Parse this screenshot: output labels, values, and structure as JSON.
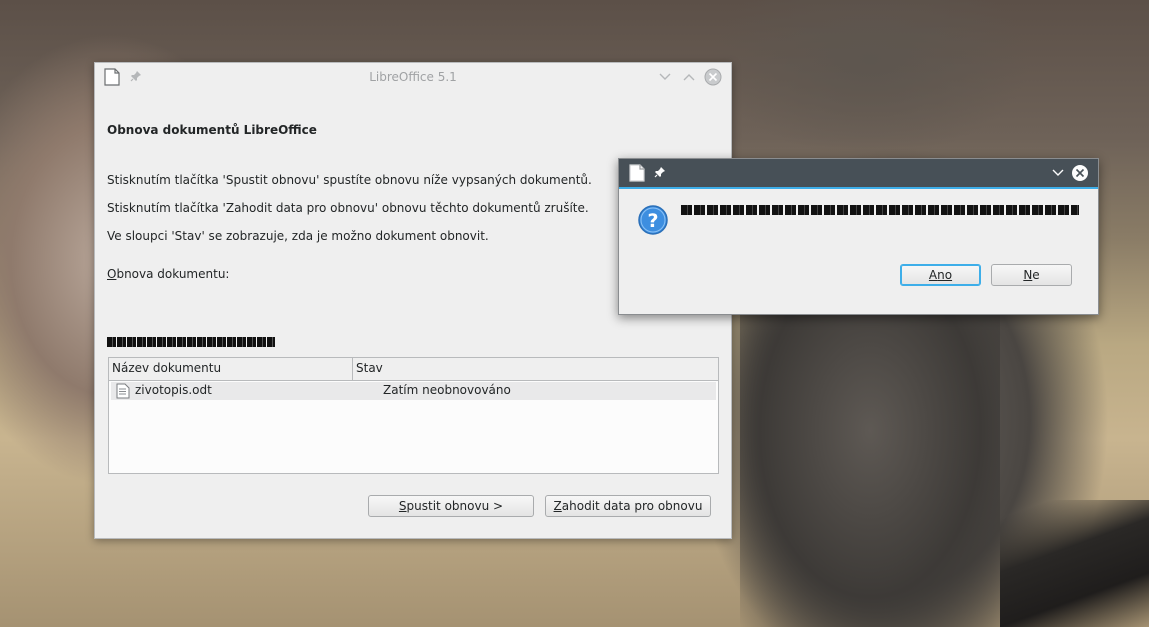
{
  "main_window": {
    "title": "LibreOffice 5.1",
    "heading": "Obnova dokumentů LibreOffice",
    "line1": "Stisknutím tlačítka 'Spustit obnovu' spustíte obnovu níže vypsaných dokumentů.",
    "line2": "Stisknutím tlačítka 'Zahodit data pro obnovu' obnovu těchto dokumentů zrušíte.",
    "line3": "Ve sloupci 'Stav' se zobrazuje, zda je možno dokument obnovit.",
    "recovery_label_first": "O",
    "recovery_label_rest": "bnova dokumentu:",
    "table": {
      "headers": [
        "Název dokumentu",
        "Stav"
      ],
      "rows": [
        {
          "name": "zivotopis.odt",
          "status": "Zatím neobnovováno"
        }
      ]
    },
    "start_button_first": "S",
    "start_button_rest": "pustit obnovu >",
    "discard_button_first": "Z",
    "discard_button_rest": "ahodit data pro obnovu"
  },
  "message_box": {
    "yes_first": "A",
    "yes_rest": "no",
    "no_first": "N",
    "no_rest": "e"
  },
  "colors": {
    "titlebar_dark": "#475057",
    "focus_blue": "#3daee9",
    "window_bg": "#efefef"
  }
}
